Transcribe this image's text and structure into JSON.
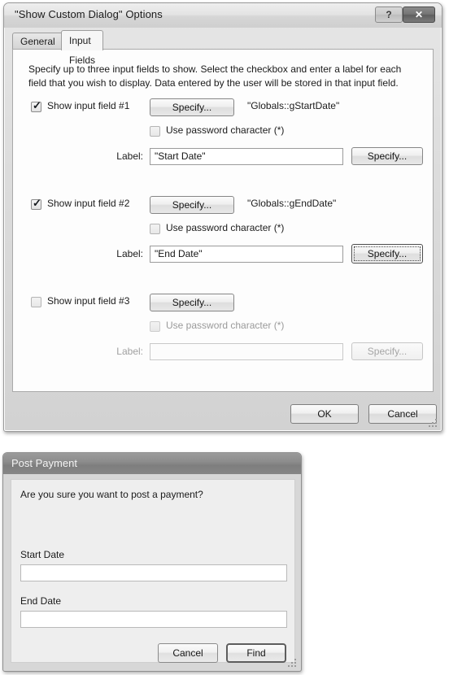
{
  "dialog1": {
    "title": "\"Show Custom Dialog\" Options",
    "help_button": "?",
    "close_button": "✕",
    "tabs": [
      {
        "label": "General",
        "active": false
      },
      {
        "label": "Input Fields",
        "active": true
      }
    ],
    "instructions": "Specify up to three input fields to show. Select the checkbox and enter a label for each field that you wish to display. Data entered by the user will be stored in that input field.",
    "password_label": "Use password character (*)",
    "label_caption": "Label:",
    "specify_label": "Specify...",
    "groups": [
      {
        "checkbox_label": "Show input field #1",
        "checked": true,
        "enabled": true,
        "target_variable": "\"Globals::gStartDate\"",
        "password_checked": false,
        "label_value": "\"Start Date\"",
        "label_specify_focused": false
      },
      {
        "checkbox_label": "Show input field #2",
        "checked": true,
        "enabled": true,
        "target_variable": "\"Globals::gEndDate\"",
        "password_checked": false,
        "label_value": "\"End Date\"",
        "label_specify_focused": true
      },
      {
        "checkbox_label": "Show input field #3",
        "checked": false,
        "enabled": false,
        "target_variable": "",
        "password_checked": false,
        "label_value": "",
        "label_specify_focused": false
      }
    ],
    "ok_label": "OK",
    "cancel_label": "Cancel"
  },
  "dialog2": {
    "title": "Post Payment",
    "message": "Are you sure you want to post a payment?",
    "fields": [
      {
        "label": "Start Date",
        "value": ""
      },
      {
        "label": "End Date",
        "value": ""
      }
    ],
    "cancel_label": "Cancel",
    "find_label": "Find"
  },
  "colors": {
    "window_chrome": "#dcdcdc",
    "panel_background": "#fdfdfd",
    "title_text": "#1b1b1b",
    "dialog2_titlebar": "#8d8d8d",
    "dialog2_title_text": "#f3f3f3",
    "disabled_text": "#a0a0a0"
  }
}
